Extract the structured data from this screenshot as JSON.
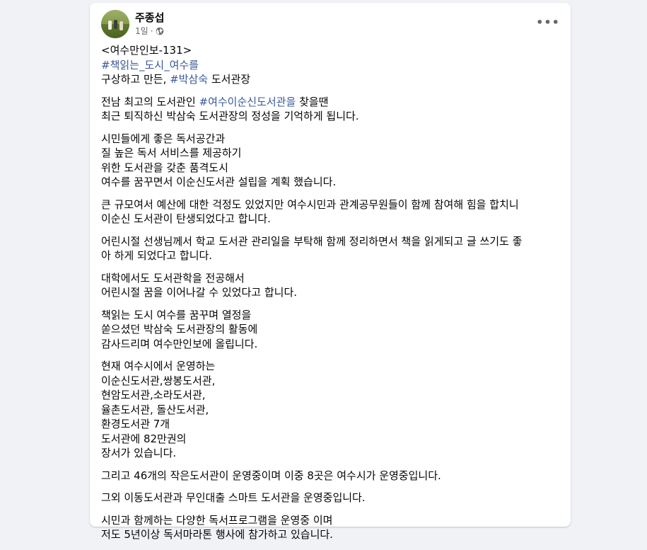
{
  "post": {
    "author": "주종섭",
    "time": "1일",
    "dot": "·",
    "more": "•••",
    "icons": {
      "privacy": "globe-icon",
      "menu": "more-horizontal-icon"
    },
    "colors": {
      "hashtag": "#385898",
      "text": "#050505",
      "meta": "#65676b"
    },
    "p1": {
      "l1": "<여수만인보-131>",
      "l2_tag": "#책읽는_도시_여수를",
      "l3_a": "구상하고 만든, ",
      "l3_tag": "#박삼숙",
      "l3_b": " 도서관장"
    },
    "p2": {
      "l1_a": "전남 최고의 도서관인 ",
      "l1_tag": "#여수이순신도서관을",
      "l1_b": " 찾을땐",
      "l2": "최근 퇴직하신 박삼숙 도서관장의 정성을 기억하게 됩니다."
    },
    "p3": [
      "시민들에게 좋은 독서공간과",
      "질 높은 독서 서비스를 제공하기",
      "위한 도서관을 갖춘 품격도시",
      "여수를 꿈꾸면서 이순신도서관 설립을 계획 했습니다."
    ],
    "p4": [
      "큰 규모여서 예산에 대한 걱정도 있었지만 여수시민과 관계공무원들이 함께 참여해 힘을 합치니",
      "이순신 도서관이 탄생되었다고 합니다."
    ],
    "p5": [
      "어린시절 선생님께서 학교 도서관 관리일을 부탁해 함께 정리하면서 책을 읽게되고 글 쓰기도 좋",
      "아 하게 되었다고 합니다."
    ],
    "p6": [
      "대학에서도 도서관학을 전공해서",
      "어린시절 꿈을 이어나갈 수 있었다고 합니다."
    ],
    "p7": [
      "책읽는 도시 여수를 꿈꾸며 열정을",
      "쏟으셨던 박삼숙 도서관장의 활동에",
      "감사드리며 여수만인보에 올립니다."
    ],
    "p8": [
      "현재 여수시에서 운영하는",
      "이순신도서관,쌍봉도서관,",
      "현암도서관,소라도서관,",
      "율촌도서관, 돌산도서관,",
      "환경도서관 7개",
      "도서관에 82만권의",
      "장서가 있습니다."
    ],
    "p9": [
      "그리고 46개의 작은도서관이 운영중이며 이중 8곳은 여수시가 운영중입니다."
    ],
    "p10": [
      "그외 이동도서관과 무인대출 스마트 도서관을 운영중입니다."
    ],
    "p11": [
      "시민과 함께하는 다양한 독서프로그램을 운영중 이며",
      "저도 5년이상 독서마라톤 행사에 참가하고 있습니다."
    ]
  }
}
